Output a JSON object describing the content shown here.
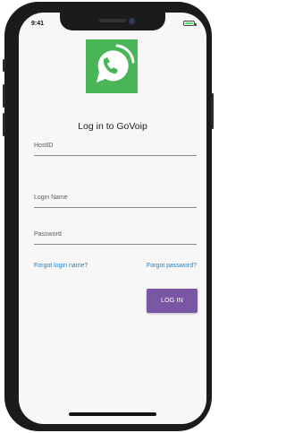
{
  "status_bar": {
    "time": "9:41"
  },
  "app": {
    "title": "Log in to GoVoip",
    "logo_icon": "phone-signal-icon",
    "colors": {
      "logo_bg": "#49b557",
      "button_bg": "#7a57a4",
      "link": "#1e7ec8"
    }
  },
  "form": {
    "host_placeholder": "HostID",
    "login_placeholder": "Login Name",
    "password_placeholder": "Password",
    "forgot_login": "Forgot login name?",
    "forgot_password": "Forgot password?",
    "login_button": "LOG IN"
  }
}
